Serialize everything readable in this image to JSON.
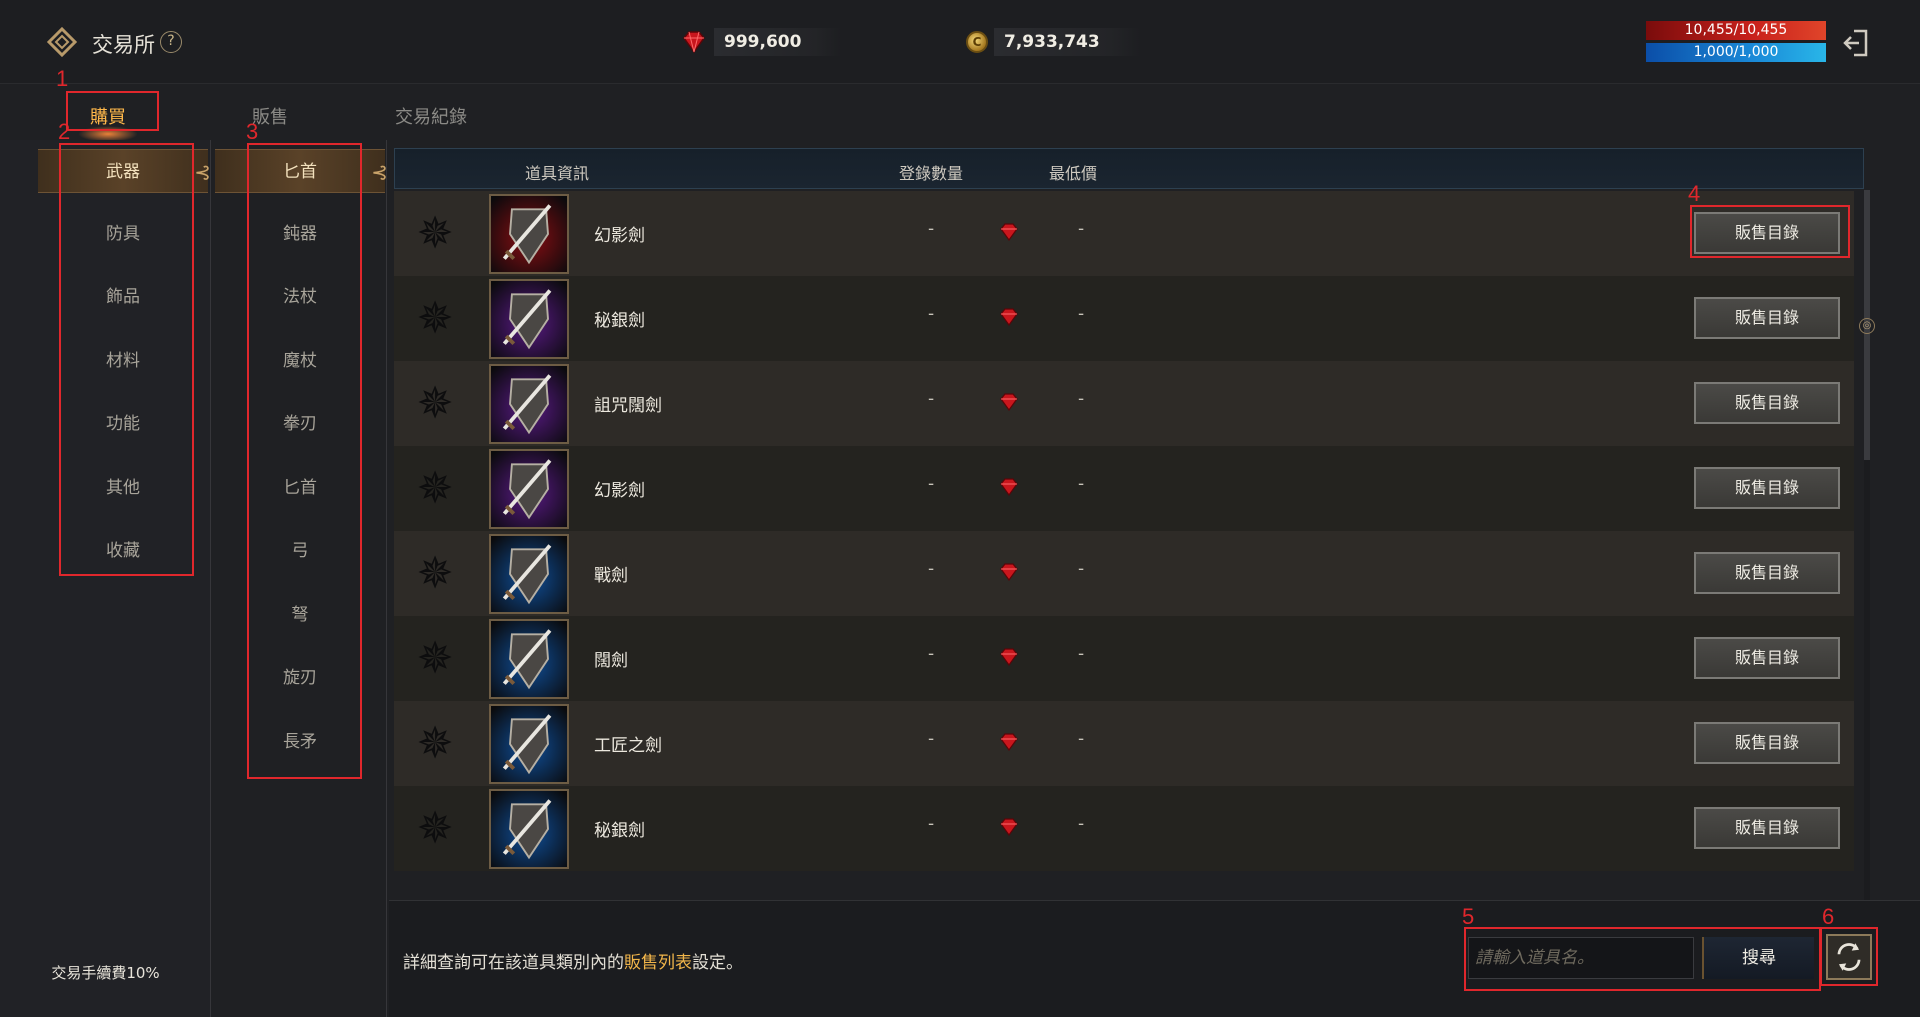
{
  "header": {
    "title": "交易所",
    "help_icon": "?",
    "diamond_amount": "999,600",
    "coin_amount": "7,933,743",
    "coin_glyph": "C",
    "hp": "10,455/10,455",
    "mp": "1,000/1,000"
  },
  "tabs": [
    {
      "label": "購買",
      "active": true
    },
    {
      "label": "販售",
      "active": false
    },
    {
      "label": "交易紀錄",
      "active": false
    }
  ],
  "categories": [
    "武器",
    "防具",
    "飾品",
    "材料",
    "功能",
    "其他",
    "收藏"
  ],
  "subcategories": [
    "匕首",
    "鈍器",
    "法杖",
    "魔杖",
    "拳刃",
    "匕首",
    "弓",
    "弩",
    "旋刃",
    "長矛"
  ],
  "fee_text": "交易手續費10%",
  "table": {
    "headers": {
      "item_info": "道具資訊",
      "count": "登錄數量",
      "min_price": "最低價"
    },
    "rows": [
      {
        "name": "幻影劍",
        "count": "-",
        "price": "-",
        "button": "販售目錄",
        "rarity": "red"
      },
      {
        "name": "秘銀劍",
        "count": "-",
        "price": "-",
        "button": "販售目錄",
        "rarity": "purple"
      },
      {
        "name": "詛咒闊劍",
        "count": "-",
        "price": "-",
        "button": "販售目錄",
        "rarity": "purple"
      },
      {
        "name": "幻影劍",
        "count": "-",
        "price": "-",
        "button": "販售目錄",
        "rarity": "purple"
      },
      {
        "name": "戰劍",
        "count": "-",
        "price": "-",
        "button": "販售目錄",
        "rarity": "blue"
      },
      {
        "name": "闊劍",
        "count": "-",
        "price": "-",
        "button": "販售目錄",
        "rarity": "blue"
      },
      {
        "name": "工匠之劍",
        "count": "-",
        "price": "-",
        "button": "販售目錄",
        "rarity": "blue"
      },
      {
        "name": "秘銀劍",
        "count": "-",
        "price": "-",
        "button": "販售目錄",
        "rarity": "blue"
      }
    ]
  },
  "bottom": {
    "hint_before": "詳細查詢可在該道具類別內的",
    "hint_link": "販售列表",
    "hint_after": "設定。",
    "search_placeholder": "請輸入道具名。",
    "search_button": "搜尋"
  },
  "annotations": [
    "1",
    "2",
    "3",
    "4",
    "5",
    "6"
  ],
  "colors": {
    "accent_orange": "#ffb84a",
    "annotation_red": "#e0272c",
    "rarity_red": "#8a0d12",
    "rarity_purple": "#5a1a86",
    "rarity_blue": "#0f4f9a"
  }
}
